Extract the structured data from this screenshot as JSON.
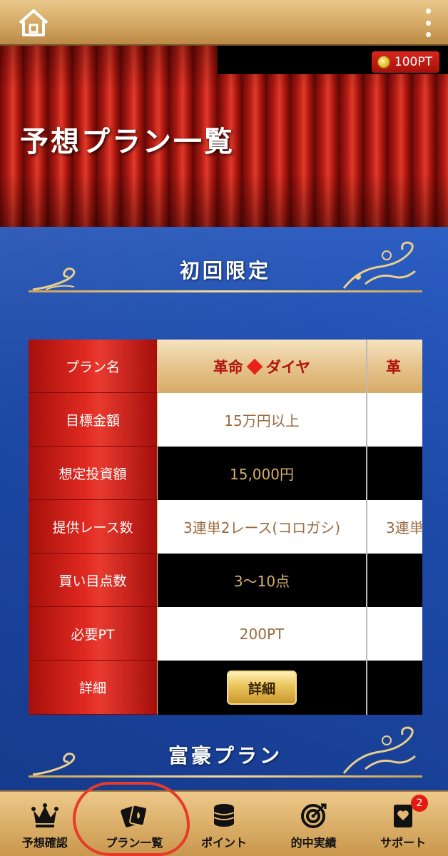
{
  "header": {
    "home_icon": "home-icon",
    "menu_icon": "more-vertical-icon"
  },
  "points": {
    "value": "100PT",
    "icon": "coin-icon"
  },
  "page_title": "予想プラン一覧",
  "sections": {
    "first": "初回限定",
    "second": "富豪プラン"
  },
  "plan_table": {
    "rows": [
      {
        "header": "プラン名",
        "value": "革命",
        "value_suffix": "ダイヤ",
        "next": "革"
      },
      {
        "header": "目標金額",
        "value": "15万円以上",
        "next": ""
      },
      {
        "header": "想定投資額",
        "value": "15,000円",
        "next": ""
      },
      {
        "header": "提供レース数",
        "value": "3連単2レース(コロガシ)",
        "next": "3連単"
      },
      {
        "header": "買い目点数",
        "value": "3〜10点",
        "next": ""
      },
      {
        "header": "必要PT",
        "value": "200PT",
        "next": ""
      },
      {
        "header": "詳細",
        "button": "詳細"
      }
    ]
  },
  "bottom_nav": [
    {
      "label": "予想確認",
      "icon": "crown-icon"
    },
    {
      "label": "プラン一覧",
      "icon": "cards-icon",
      "active": true
    },
    {
      "label": "ポイント",
      "icon": "coins-icon"
    },
    {
      "label": "的中実績",
      "icon": "target-icon"
    },
    {
      "label": "サポート",
      "icon": "support-card-icon",
      "badge": "2"
    }
  ],
  "colors": {
    "accent_red": "#e12a21",
    "gold": "#d8ab64",
    "blue": "#1d4aa8"
  }
}
